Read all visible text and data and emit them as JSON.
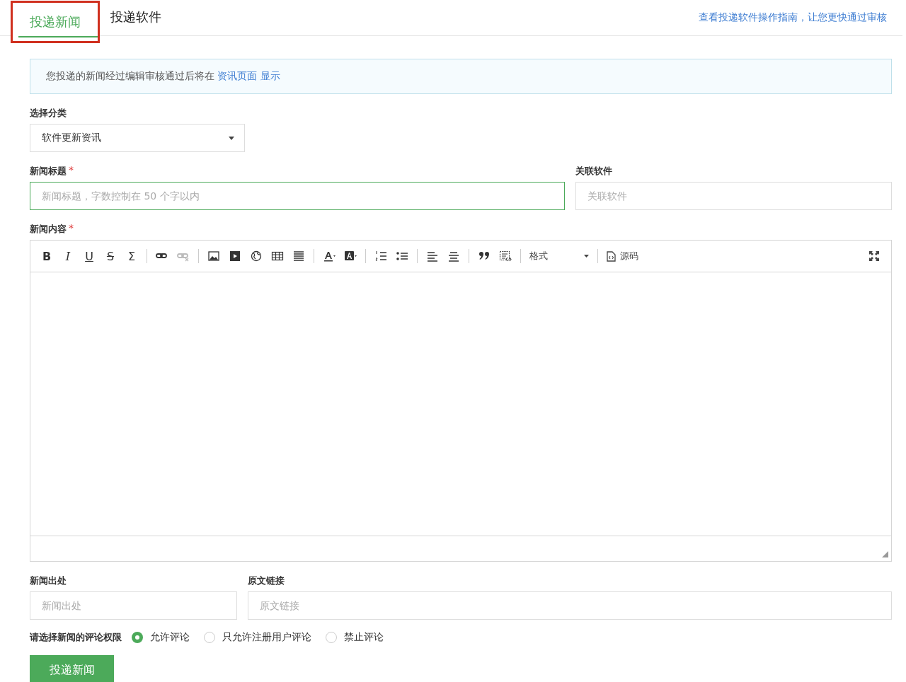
{
  "tabs": [
    {
      "label": "投递新闻",
      "selected": true,
      "highlighted": true
    },
    {
      "label": "投递软件",
      "selected": false,
      "highlighted": false
    }
  ],
  "guide_link": "查看投递软件操作指南，让您更快通过审核",
  "notice": {
    "text": "您投递的新闻经过编辑审核通过后将在",
    "link": "资讯页面 显示"
  },
  "category": {
    "label": "选择分类",
    "value": "软件更新资讯"
  },
  "title_field": {
    "label": "新闻标题",
    "required_mark": "*",
    "focused": true,
    "placeholder": "新闻标题，字数控制在 50 个字以内"
  },
  "related_field": {
    "label": "关联软件",
    "focused": false,
    "placeholder": "关联软件"
  },
  "content": {
    "label": "新闻内容",
    "required_mark": "*",
    "toolbar": [
      [
        {
          "kind": "bold",
          "label": "B",
          "disabled": false
        },
        {
          "kind": "italic",
          "label": "I",
          "disabled": false
        },
        {
          "kind": "underline",
          "label": "U",
          "disabled": false
        },
        {
          "kind": "strike",
          "label": "S",
          "disabled": false
        },
        {
          "kind": "sigma",
          "label": "Σ",
          "disabled": false
        }
      ],
      [
        {
          "kind": "link",
          "disabled": false
        },
        {
          "kind": "unlink",
          "disabled": true
        }
      ],
      [
        {
          "kind": "image",
          "disabled": false
        },
        {
          "kind": "video",
          "disabled": false
        },
        {
          "kind": "globe",
          "disabled": false
        },
        {
          "kind": "table",
          "disabled": false
        },
        {
          "kind": "rule",
          "disabled": false
        }
      ],
      [
        {
          "kind": "textcolor",
          "disabled": false
        },
        {
          "kind": "bgcolor",
          "disabled": false
        }
      ],
      [
        {
          "kind": "ol",
          "disabled": false
        },
        {
          "kind": "ul",
          "disabled": false
        }
      ],
      [
        {
          "kind": "alignleft",
          "disabled": false
        },
        {
          "kind": "aligncenter",
          "disabled": false
        }
      ],
      [
        {
          "kind": "quote",
          "disabled": false
        },
        {
          "kind": "template",
          "disabled": false
        }
      ],
      [
        {
          "kind": "format",
          "label": "格式",
          "disabled": false
        }
      ],
      [
        {
          "kind": "source",
          "label": "源码",
          "disabled": false
        }
      ]
    ]
  },
  "source_field": {
    "label": "新闻出处",
    "placeholder": "新闻出处"
  },
  "origin_field": {
    "label": "原文链接",
    "placeholder": "原文链接"
  },
  "comments": {
    "label": "请选择新闻的评论权限",
    "options": [
      {
        "label": "允许评论",
        "selected": true
      },
      {
        "label": "只允许注册用户评论",
        "selected": false
      },
      {
        "label": "禁止评论",
        "selected": false
      }
    ]
  },
  "submit": "投递新闻"
}
